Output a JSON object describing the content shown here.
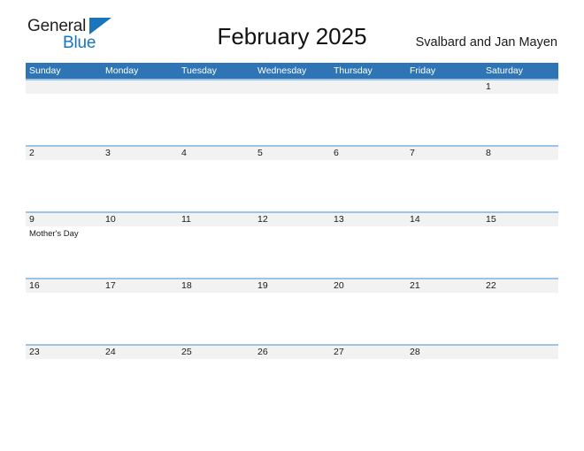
{
  "brand": {
    "name_part1": "General",
    "name_part2": "Blue",
    "accent_color": "#1b75bb",
    "triangle_icon": "triangle-icon"
  },
  "header": {
    "title": "February 2025",
    "region": "Svalbard and Jan Mayen"
  },
  "colors": {
    "header_blue": "#2f75b5",
    "row_rule_blue": "#9dc3e6",
    "date_row_gray": "#f2f2f2",
    "text_dark": "#1a1a1a",
    "white": "#ffffff"
  },
  "calendar": {
    "month": "February",
    "year": "2025",
    "weekday_headers": [
      "Sunday",
      "Monday",
      "Tuesday",
      "Wednesday",
      "Thursday",
      "Friday",
      "Saturday"
    ],
    "weeks": [
      {
        "days": [
          {
            "date": "",
            "events": []
          },
          {
            "date": "",
            "events": []
          },
          {
            "date": "",
            "events": []
          },
          {
            "date": "",
            "events": []
          },
          {
            "date": "",
            "events": []
          },
          {
            "date": "",
            "events": []
          },
          {
            "date": "1",
            "events": []
          }
        ]
      },
      {
        "days": [
          {
            "date": "2",
            "events": []
          },
          {
            "date": "3",
            "events": []
          },
          {
            "date": "4",
            "events": []
          },
          {
            "date": "5",
            "events": []
          },
          {
            "date": "6",
            "events": []
          },
          {
            "date": "7",
            "events": []
          },
          {
            "date": "8",
            "events": []
          }
        ]
      },
      {
        "days": [
          {
            "date": "9",
            "events": [
              "Mother's Day"
            ]
          },
          {
            "date": "10",
            "events": []
          },
          {
            "date": "11",
            "events": []
          },
          {
            "date": "12",
            "events": []
          },
          {
            "date": "13",
            "events": []
          },
          {
            "date": "14",
            "events": []
          },
          {
            "date": "15",
            "events": []
          }
        ]
      },
      {
        "days": [
          {
            "date": "16",
            "events": []
          },
          {
            "date": "17",
            "events": []
          },
          {
            "date": "18",
            "events": []
          },
          {
            "date": "19",
            "events": []
          },
          {
            "date": "20",
            "events": []
          },
          {
            "date": "21",
            "events": []
          },
          {
            "date": "22",
            "events": []
          }
        ]
      },
      {
        "days": [
          {
            "date": "23",
            "events": []
          },
          {
            "date": "24",
            "events": []
          },
          {
            "date": "25",
            "events": []
          },
          {
            "date": "26",
            "events": []
          },
          {
            "date": "27",
            "events": []
          },
          {
            "date": "28",
            "events": []
          },
          {
            "date": "",
            "events": []
          }
        ]
      }
    ]
  }
}
